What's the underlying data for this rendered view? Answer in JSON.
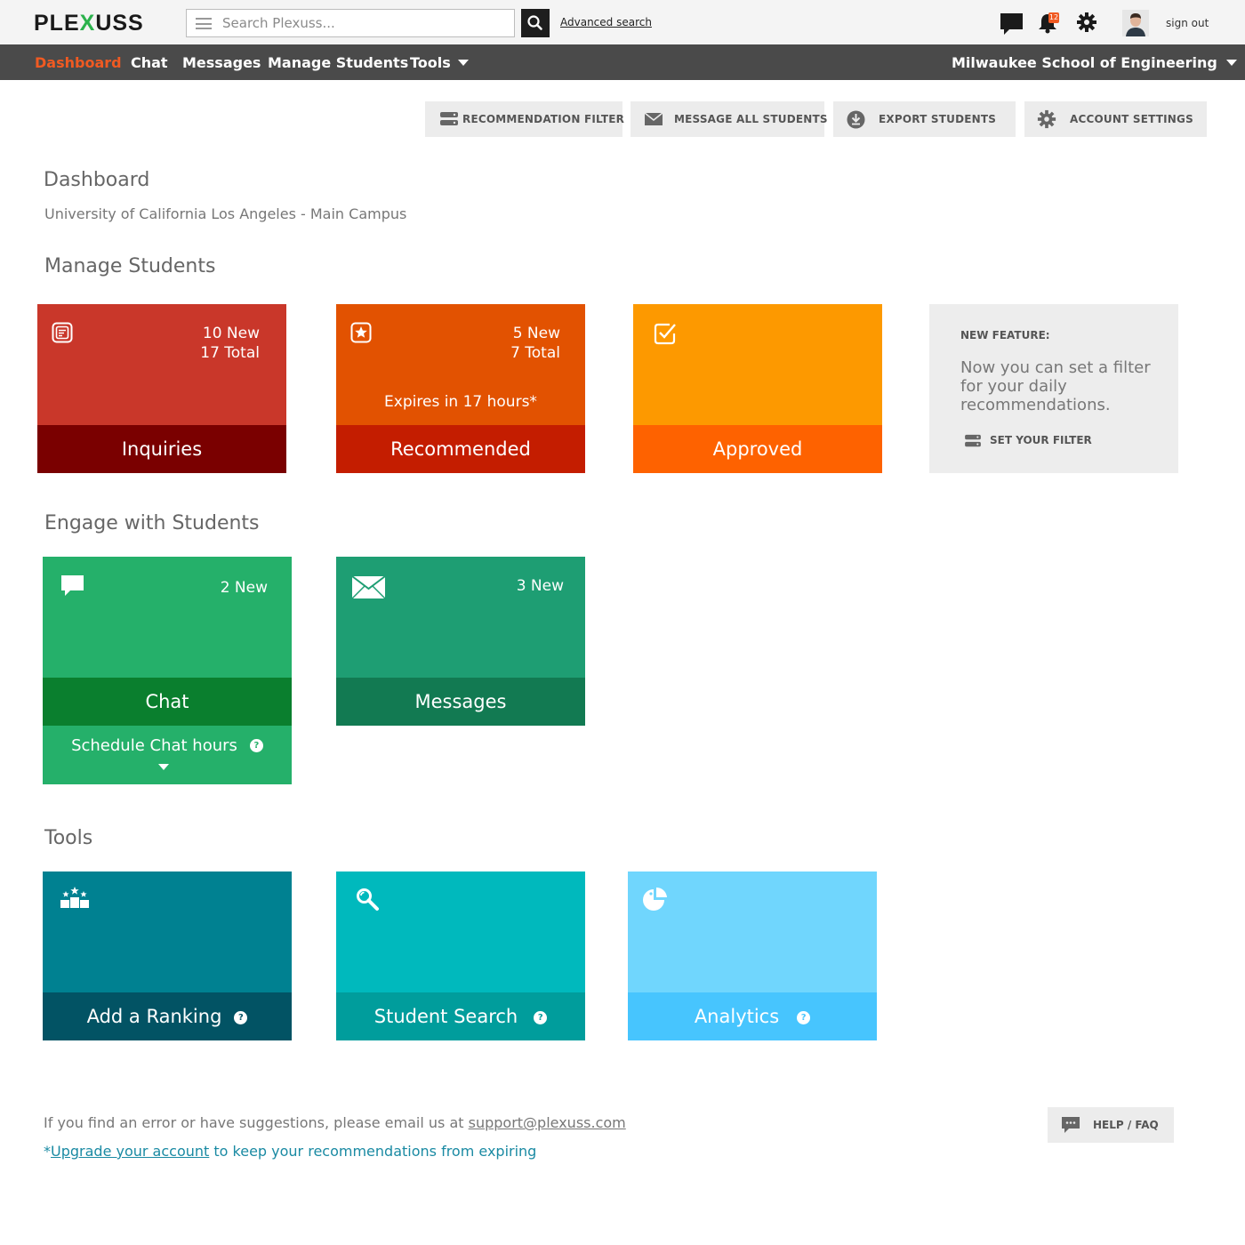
{
  "header": {
    "logo_pre": "PLE",
    "logo_x": "X",
    "logo_post": "USS",
    "search_placeholder": "Search Plexuss...",
    "advanced_search": "Advanced search",
    "notification_count": "12",
    "sign_out": "sign out"
  },
  "nav": {
    "items": [
      {
        "label": "Dashboard"
      },
      {
        "label": "Chat"
      },
      {
        "label": "Messages"
      },
      {
        "label": "Manage Students"
      },
      {
        "label": "Tools"
      }
    ],
    "school": "Milwaukee School of Engineering"
  },
  "actions": {
    "recommendation_filter": "RECOMMENDATION FILTER",
    "message_all": "MESSAGE  ALL STUDENTS",
    "export_students": "EXPORT STUDENTS",
    "account_settings": "ACCOUNT SETTINGS"
  },
  "page": {
    "title": "Dashboard",
    "subtitle": "University of California Los Angeles - Main Campus"
  },
  "manage": {
    "title": "Manage Students",
    "inquiries": {
      "new": "10 New",
      "total": "17 Total",
      "label": "Inquiries"
    },
    "recommended": {
      "new": "5 New",
      "total": "7 Total",
      "expires": "Expires in 17 hours*",
      "label": "Recommended"
    },
    "approved": {
      "label": "Approved"
    },
    "feature": {
      "title": "NEW FEATURE:",
      "text": "Now you can set a filter for your daily recommendations.",
      "link": "SET YOUR FILTER"
    }
  },
  "engage": {
    "title": "Engage with Students",
    "chat": {
      "new": "2 New",
      "label": "Chat",
      "schedule": "Schedule Chat hours"
    },
    "messages": {
      "new": "3 New",
      "label": "Messages"
    }
  },
  "tools": {
    "title": "Tools",
    "ranking": {
      "label": "Add a Ranking"
    },
    "search": {
      "label": "Student Search"
    },
    "analytics": {
      "label": "Analytics"
    },
    "help_mark": "?"
  },
  "footer": {
    "text_pre": "If you find an error or have suggestions, please email us at ",
    "email": "support@plexuss.com",
    "upgrade_star": "*",
    "upgrade_link": "Upgrade your account",
    "upgrade_post": " to keep your recommendations from expiring",
    "help": "HELP / FAQ"
  },
  "colors": {
    "accent": "#f05a22",
    "inquiries_top": "#c9372a",
    "inquiries_bottom": "#7a0000",
    "recommended_top": "#e25201",
    "recommended_bottom": "#c41d00",
    "approved_top": "#fd9900",
    "approved_bottom": "#fe6200",
    "chat_top": "#25b06a",
    "chat_bottom": "#0a7f2e",
    "messages_top": "#1e9e73",
    "messages_bottom": "#127a52",
    "ranking_top": "#008191",
    "ranking_bottom": "#025364",
    "search_top": "#00b9bd",
    "search_bottom": "#009d9c",
    "analytics_top": "#70d6fd",
    "analytics_bottom": "#47c5fe"
  }
}
